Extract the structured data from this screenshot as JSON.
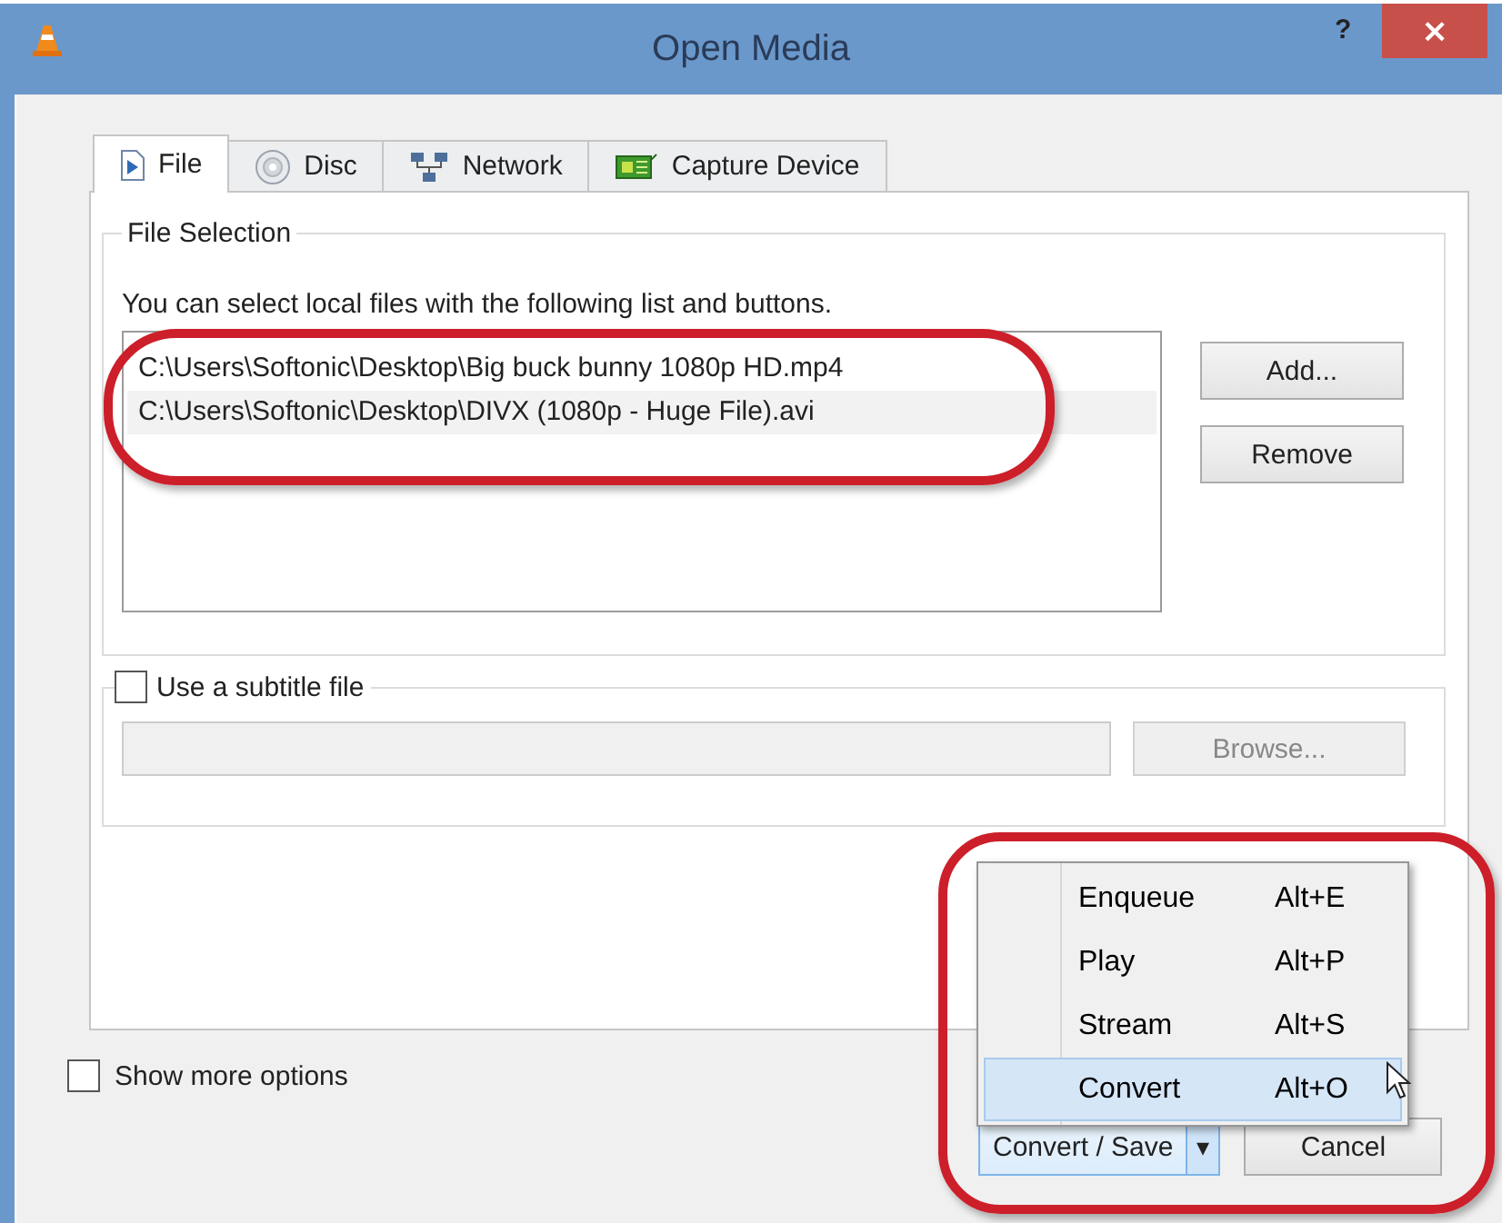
{
  "window": {
    "title": "Open Media",
    "help": "?",
    "close": "×"
  },
  "tabs": [
    {
      "label": "File",
      "kind": "file",
      "selected": true
    },
    {
      "label": "Disc",
      "kind": "disc",
      "selected": false
    },
    {
      "label": "Network",
      "kind": "network",
      "selected": false
    },
    {
      "label": "Capture Device",
      "kind": "capture",
      "selected": false
    }
  ],
  "file_selection": {
    "title": "File Selection",
    "hint": "You can select local files with the following list and buttons.",
    "files": [
      {
        "path": "C:\\Users\\Softonic\\Desktop\\Big buck bunny 1080p HD.mp4"
      },
      {
        "path": "C:\\Users\\Softonic\\Desktop\\DIVX (1080p - Huge File).avi"
      }
    ],
    "buttons": [
      "Add...",
      "Remove"
    ]
  },
  "subtitle": {
    "label": "Use a subtitle file",
    "checked": false,
    "browse": "Browse..."
  },
  "show_more_options": {
    "label": "Show more options",
    "checked": false
  },
  "menu": [
    {
      "label": "Enqueue",
      "shortcut": "Alt+E",
      "selected": false
    },
    {
      "label": "Play",
      "shortcut": "Alt+P",
      "selected": false
    },
    {
      "label": "Stream",
      "shortcut": "Alt+S",
      "selected": false
    },
    {
      "label": "Convert",
      "shortcut": "Alt+O",
      "selected": true
    }
  ],
  "buttons": {
    "convert_save": "Convert / Save",
    "dropdown": "▾",
    "cancel": "Cancel"
  }
}
